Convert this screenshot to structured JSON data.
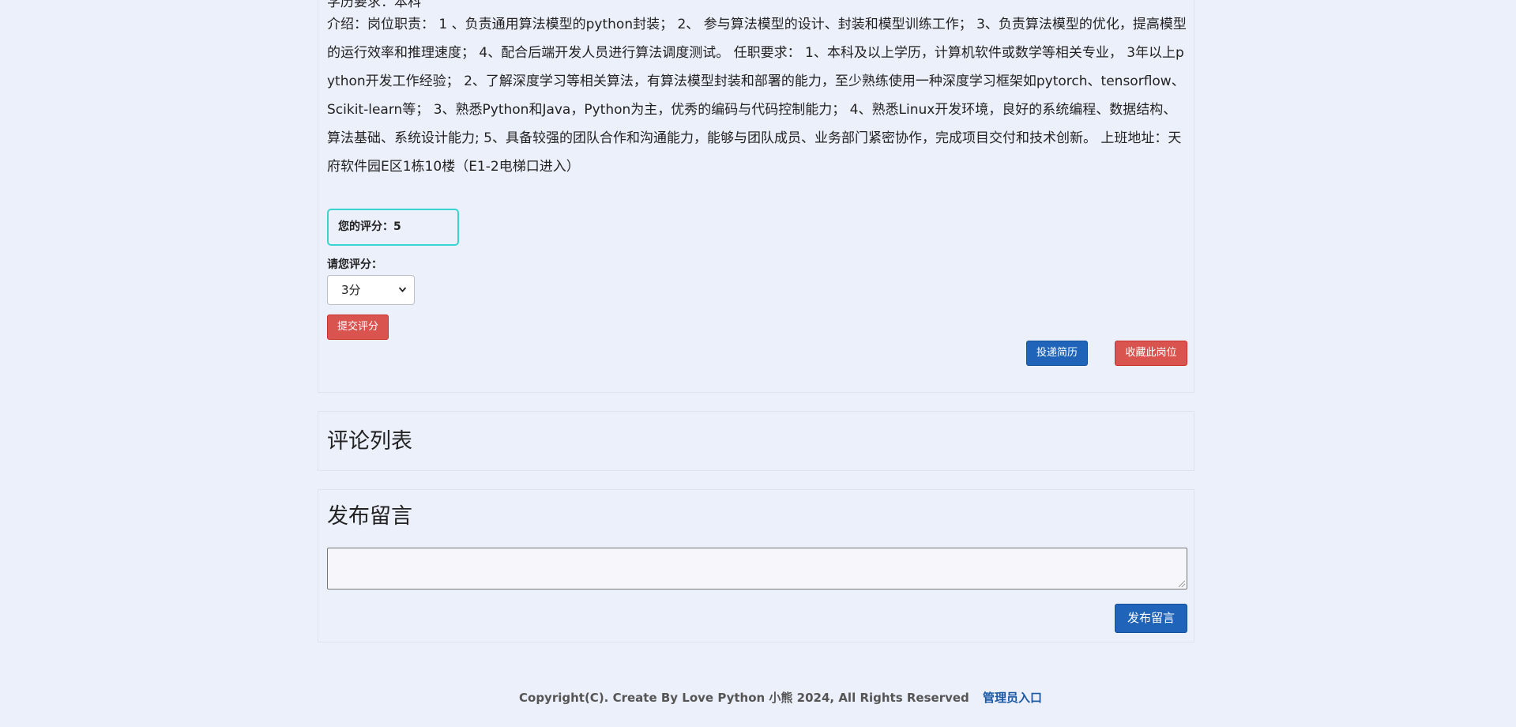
{
  "job": {
    "education": "学历要求：本科",
    "description": "介绍：岗位职责： 1 、负责通用算法模型的python封装； 2、 参与算法模型的设计、封装和模型训练工作； 3、负责算法模型的优化，提高模型的运行效率和推理速度； 4、配合后端开发人员进行算法调度测试。 任职要求： 1、本科及以上学历，计算机软件或数学等相关专业， 3年以上python开发工作经验； 2、了解深度学习等相关算法，有算法模型封装和部署的能力，至少熟练使用一种深度学习框架如pytorch、tensorflow、Scikit-learn等； 3、熟悉Python和Java，Python为主，优秀的编码与代码控制能力； 4、熟悉Linux开发环境，良好的系统编程、数据结构、算法基础、系统设计能力; 5、具备较强的团队合作和沟通能力，能够与团队成员、业务部门紧密协作，完成项目交付和技术创新。 上班地址：天府软件园E区1栋10楼（E1-2电梯口进入）"
  },
  "rating": {
    "current_label": "您的评分：5",
    "prompt_label": "请您评分：",
    "selected_option": "3分",
    "submit_label": "提交评分"
  },
  "actions": {
    "resume_label": "投递简历",
    "favorite_label": "收藏此岗位"
  },
  "comments": {
    "title": "评论列表"
  },
  "post": {
    "title": "发布留言",
    "textarea_value": "",
    "submit_label": "发布留言"
  },
  "footer": {
    "copyright": "Copyright(C). Create By Love Python 小熊 2024, All Rights Reserved",
    "admin_link": "管理员入口"
  },
  "icons": {
    "select_chevron": "chevron-down-icon"
  }
}
